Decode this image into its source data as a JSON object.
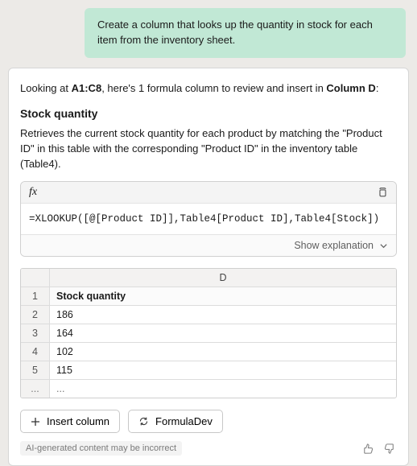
{
  "prompt": "Create a column that looks up the quantity in stock for each item from the inventory sheet.",
  "intro": {
    "prefix": "Looking at ",
    "range": "A1:C8",
    "mid": ", here's 1 formula column to review and insert in ",
    "target": "Column D",
    "suffix": ":"
  },
  "section_title": "Stock quantity",
  "description": "Retrieves the current stock quantity for each product by matching the \"Product ID\" in this table with the corresponding \"Product ID\" in the inventory table (Table4).",
  "fx_label": "fx",
  "formula": "=XLOOKUP([@[Product ID]],Table4[Product ID],Table4[Stock])",
  "show_explanation": "Show explanation",
  "preview": {
    "col_header": "D",
    "title": "Stock quantity",
    "rows": [
      {
        "n": "1",
        "v": "Stock quantity"
      },
      {
        "n": "2",
        "v": "186"
      },
      {
        "n": "3",
        "v": "164"
      },
      {
        "n": "4",
        "v": "102"
      },
      {
        "n": "5",
        "v": "115"
      },
      {
        "n": "...",
        "v": "..."
      }
    ]
  },
  "buttons": {
    "insert": "Insert column",
    "formuladev": "FormulaDev"
  },
  "disclaimer": "AI-generated content may be incorrect",
  "chart_data": {
    "type": "table",
    "columns": [
      "D"
    ],
    "header": "Stock quantity",
    "values": [
      186,
      164,
      102,
      115
    ]
  }
}
